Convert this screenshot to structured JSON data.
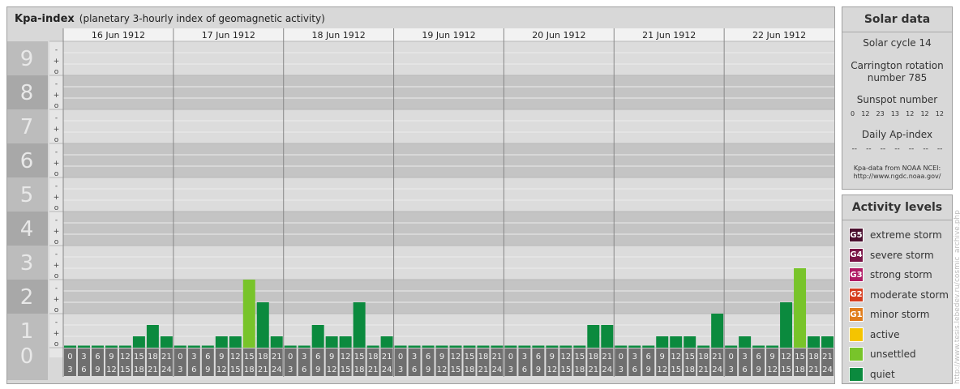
{
  "header": {
    "title": "Kpa-index",
    "subtitle": "(planetary 3-hourly index of geomagnetic activity)"
  },
  "solar": {
    "title": "Solar data",
    "cycle": "Solar cycle 14",
    "carrington_line1": "Carrington rotation",
    "carrington_line2": "number 785",
    "sunspot_title": "Sunspot number",
    "sunspot_values": [
      "0",
      "12",
      "23",
      "13",
      "12",
      "12",
      "12"
    ],
    "ap_title": "Daily Ap-index",
    "ap_values": [
      "--",
      "--",
      "--",
      "--",
      "--",
      "--",
      "--"
    ],
    "source_line1": "Kpa-data from NOAA NCEI:",
    "source_line2": "http://www.ngdc.noaa.gov/"
  },
  "levels": {
    "title": "Activity levels",
    "items": [
      {
        "badge": "G5",
        "label": "extreme storm",
        "color": "#4a0f2e"
      },
      {
        "badge": "G4",
        "label": "severe storm",
        "color": "#7a1446"
      },
      {
        "badge": "G3",
        "label": "strong storm",
        "color": "#b01a64"
      },
      {
        "badge": "G2",
        "label": "moderate storm",
        "color": "#d63c1e"
      },
      {
        "badge": "G1",
        "label": "minor storm",
        "color": "#e07d1c"
      },
      {
        "badge": "",
        "label": "active",
        "color": "#f5c400"
      },
      {
        "badge": "",
        "label": "unsettled",
        "color": "#78c42a"
      },
      {
        "badge": "",
        "label": "quiet",
        "color": "#0b8a3e"
      }
    ]
  },
  "watermark": "http://www.tesis.lebedev.ru/cosmic_archive.php",
  "chart_data": {
    "type": "bar",
    "ylim": [
      0,
      9
    ],
    "y_major_ticks": [
      "0",
      "1",
      "2",
      "3",
      "4",
      "5",
      "6",
      "7",
      "8",
      "9"
    ],
    "y_minor_ticks": [
      "o",
      "+",
      "-"
    ],
    "days": [
      "16 Jun 1912",
      "17 Jun 1912",
      "18 Jun 1912",
      "19 Jun 1912",
      "20 Jun 1912",
      "21 Jun 1912",
      "22 Jun 1912"
    ],
    "interval_top": [
      "0",
      "3",
      "6",
      "9",
      "12",
      "15",
      "18",
      "21"
    ],
    "interval_bottom": [
      "3",
      "6",
      "9",
      "12",
      "15",
      "18",
      "21",
      "24"
    ],
    "values": [
      [
        0,
        0,
        0,
        0,
        0,
        0.333,
        0.667,
        0.333
      ],
      [
        0,
        0,
        0,
        0.333,
        0.333,
        2.0,
        1.333,
        0.333
      ],
      [
        0,
        0,
        0.667,
        0.333,
        0.333,
        1.333,
        0,
        0.333
      ],
      [
        0,
        0,
        0,
        0,
        0,
        0,
        0,
        0
      ],
      [
        0,
        0,
        0,
        0,
        0,
        0,
        0.667,
        0.667
      ],
      [
        0,
        0,
        0,
        0.333,
        0.333,
        0.333,
        0,
        1.0
      ],
      [
        0,
        0.333,
        0,
        0,
        1.333,
        2.333,
        0.333,
        0.333
      ]
    ],
    "colors": {
      "quiet": "#0b8a3e",
      "unsettled": "#78c42a",
      "active": "#f5c400"
    }
  }
}
